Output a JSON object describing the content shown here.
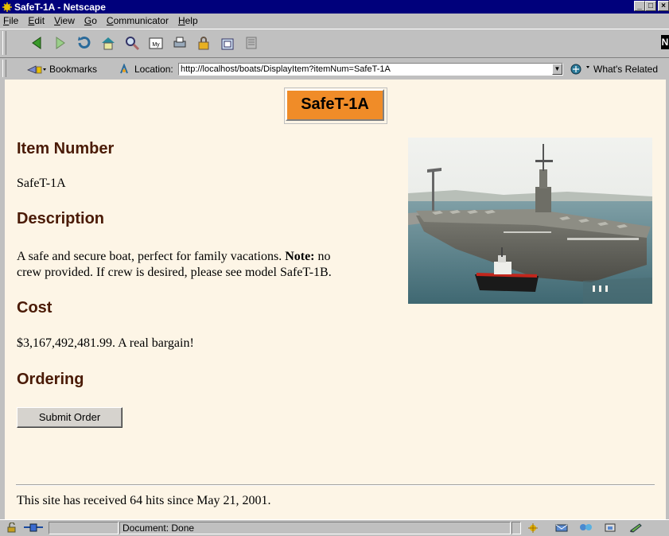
{
  "window": {
    "title": "SafeT-1A - Netscape",
    "buttons": [
      "_",
      "□",
      "×"
    ]
  },
  "menu": [
    "File",
    "Edit",
    "View",
    "Go",
    "Communicator",
    "Help"
  ],
  "menu_underlines": [
    "F",
    "E",
    "V",
    "G",
    "C",
    "H"
  ],
  "toolbar": {
    "icons": [
      "back-icon",
      "forward-icon",
      "reload-icon",
      "home-icon",
      "search-icon",
      "my-netscape-icon",
      "print-icon",
      "security-icon",
      "shop-icon",
      "stop-icon"
    ],
    "netscape_logo": "N"
  },
  "location_bar": {
    "bookmarks_label": "Bookmarks",
    "location_label": "Location:",
    "url": "http://localhost/boats/DisplayItem?itemNum=SafeT-1A",
    "whats_related_label": "What's Related"
  },
  "page": {
    "title_button": "SafeT-1A",
    "item_number_heading": "Item Number",
    "item_number": "SafeT-1A",
    "description_heading": "Description",
    "description_line1_a": "A safe and secure boat, perfect for family vacations. ",
    "description_note": "Note:",
    "description_line1_b": " no",
    "description_line2": "crew provided. If crew is desired, please see model SafeT-1B.",
    "cost_heading": "Cost",
    "cost_text": "$3,167,492,481.99. A real bargain!",
    "ordering_heading": "Ordering",
    "submit_label": "Submit Order",
    "footer_text": "This site has received 64 hits since May 21, 2001."
  },
  "status": {
    "text": "Document: Done"
  },
  "colors": {
    "heading": "#4a1a05",
    "background": "#fdf5e6",
    "title_button": "#f08c28",
    "titlebar": "#00007b"
  }
}
